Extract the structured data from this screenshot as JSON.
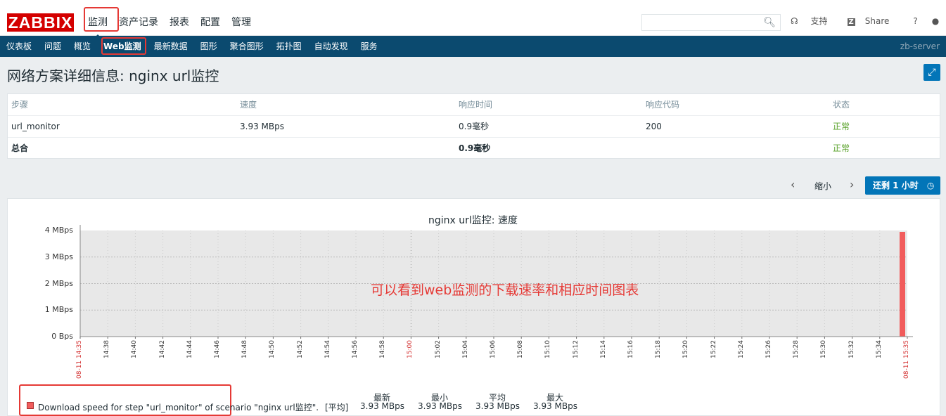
{
  "brand": "ZABBIX",
  "main_menu": [
    "监测",
    "资产记录",
    "报表",
    "配置",
    "管理"
  ],
  "tools": {
    "support": "支持",
    "share": "Share",
    "help": "?"
  },
  "sub_menu": [
    "仪表板",
    "问题",
    "概览",
    "Web监测",
    "最新数据",
    "图形",
    "聚合图形",
    "拓扑图",
    "自动发现",
    "服务"
  ],
  "server": "zb-server",
  "page_title": "网络方案详细信息: nginx url监控",
  "table": {
    "headers": [
      "步骤",
      "速度",
      "响应时间",
      "响应代码",
      "状态"
    ],
    "rows": [
      [
        "url_monitor",
        "3.93 MBps",
        "0.9毫秒",
        "200",
        "正常"
      ]
    ],
    "total": [
      "总合",
      "",
      "0.9毫秒",
      "",
      "正常"
    ]
  },
  "nav": {
    "zoom_out": "缩小",
    "back_btn": "还剩 1 小时"
  },
  "graph": {
    "title": "nginx url监控: 速度",
    "y_ticks": [
      "4 MBps",
      "3 MBps",
      "2 MBps",
      "1 MBps",
      "0 Bps"
    ],
    "x_ticks": [
      "08-11 14:35",
      "14:38",
      "14:40",
      "14:42",
      "14:44",
      "14:46",
      "14:48",
      "14:50",
      "14:52",
      "14:54",
      "14:56",
      "14:58",
      "15:00",
      "15:02",
      "15:04",
      "15:06",
      "15:08",
      "15:10",
      "15:12",
      "15:14",
      "15:16",
      "15:18",
      "15:20",
      "15:22",
      "15:24",
      "15:26",
      "15:28",
      "15:30",
      "15:32",
      "15:34",
      "08-11 15:35"
    ],
    "annotation": "可以看到web监测的下载速率和相应时间图表",
    "legend": {
      "label": "Download speed for step \"url_monitor\" of scenario \"nginx url监控\".",
      "func": "[平均]",
      "headers": [
        "最新",
        "最小",
        "平均",
        "最大"
      ],
      "values": [
        "3.93 MBps",
        "3.93 MBps",
        "3.93 MBps",
        "3.93 MBps"
      ]
    },
    "series_color": "#f15c5c"
  }
}
